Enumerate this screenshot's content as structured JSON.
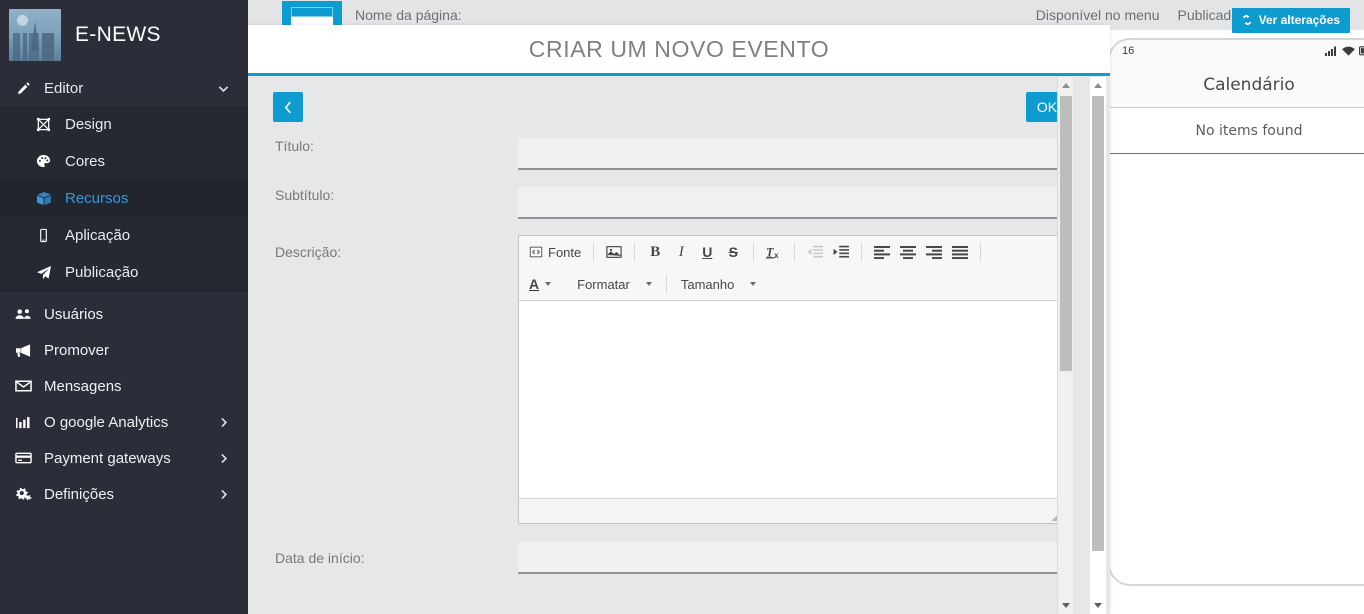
{
  "app": {
    "brand": "E-NEWS",
    "logo_icon": "city-skyline-logo"
  },
  "sidebar": {
    "editor_group": {
      "label": "Editor",
      "icon": "pencil-icon",
      "chevron": "chevron-down-icon",
      "expanded": true,
      "items": [
        {
          "label": "Design",
          "icon": "design-frame-icon",
          "active": false
        },
        {
          "label": "Cores",
          "icon": "palette-icon",
          "active": false
        },
        {
          "label": "Recursos",
          "icon": "cube-icon",
          "active": true
        },
        {
          "label": "Aplicação",
          "icon": "mobile-icon",
          "active": false
        },
        {
          "label": "Publicação",
          "icon": "paper-plane-icon",
          "active": false
        }
      ]
    },
    "items": [
      {
        "label": "Usuários",
        "icon": "users-icon",
        "chevron": false
      },
      {
        "label": "Promover",
        "icon": "megaphone-icon",
        "chevron": false
      },
      {
        "label": "Mensagens",
        "icon": "envelope-icon",
        "chevron": false
      },
      {
        "label": "O google Analytics",
        "icon": "bar-chart-icon",
        "chevron": true
      },
      {
        "label": "Payment gateways",
        "icon": "credit-card-icon",
        "chevron": true
      },
      {
        "label": "Definições",
        "icon": "gears-icon",
        "chevron": true
      }
    ]
  },
  "topbar": {
    "page_thumb_icon": "page-thumbnail-icon",
    "page_name_label": "Nome da página:",
    "menu_availability": "Disponível no menu",
    "published": "Publicados",
    "view_changes_button": "Ver alterações",
    "view_changes_icon": "refresh-icon"
  },
  "preview": {
    "status_time": "16",
    "status_icons": [
      "signal-icon",
      "wifi-icon",
      "battery-icon"
    ],
    "title": "Calendário",
    "empty_text": "No items found"
  },
  "modal": {
    "title": "CRIAR UM NOVO EVENTO",
    "back_button": "‹",
    "back_icon": "chevron-left-icon",
    "ok_button": "OK",
    "fields": {
      "titulo": {
        "label": "Título:",
        "value": "",
        "placeholder": ""
      },
      "subtitulo": {
        "label": "Subtítulo:",
        "value": "",
        "placeholder": ""
      },
      "descricao": {
        "label": "Descrição:",
        "value": ""
      },
      "data_inicio": {
        "label": "Data de início:",
        "value": "",
        "placeholder": ""
      }
    },
    "editor": {
      "row1": [
        {
          "type": "button",
          "name": "source-button",
          "label": "Fonte",
          "icon": "source-code-icon",
          "disabled": false
        },
        {
          "type": "sep"
        },
        {
          "type": "button",
          "name": "image-button",
          "label": "",
          "icon": "image-icon",
          "disabled": false
        },
        {
          "type": "sep"
        },
        {
          "type": "button",
          "name": "bold-button",
          "label": "B",
          "icon": "bold-icon",
          "disabled": false
        },
        {
          "type": "button",
          "name": "italic-button",
          "label": "I",
          "icon": "italic-icon",
          "disabled": false
        },
        {
          "type": "button",
          "name": "underline-button",
          "label": "U",
          "icon": "underline-icon",
          "disabled": false
        },
        {
          "type": "button",
          "name": "strikethrough-button",
          "label": "S",
          "icon": "strikethrough-icon",
          "disabled": false
        },
        {
          "type": "sep"
        },
        {
          "type": "button",
          "name": "remove-format-button",
          "label": "Tx",
          "icon": "remove-format-icon",
          "disabled": false
        },
        {
          "type": "sep"
        },
        {
          "type": "button",
          "name": "outdent-button",
          "label": "",
          "icon": "outdent-icon",
          "disabled": true
        },
        {
          "type": "button",
          "name": "indent-button",
          "label": "",
          "icon": "indent-icon",
          "disabled": false
        },
        {
          "type": "sep"
        },
        {
          "type": "button",
          "name": "align-left-button",
          "label": "",
          "icon": "align-left-icon",
          "disabled": false
        },
        {
          "type": "button",
          "name": "align-center-button",
          "label": "",
          "icon": "align-center-icon",
          "disabled": false
        },
        {
          "type": "button",
          "name": "align-right-button",
          "label": "",
          "icon": "align-right-icon",
          "disabled": false
        },
        {
          "type": "button",
          "name": "align-justify-button",
          "label": "",
          "icon": "align-justify-icon",
          "disabled": false
        },
        {
          "type": "sep"
        }
      ],
      "text_color_label": "A",
      "format_label": "Formatar",
      "size_label": "Tamanho"
    }
  },
  "colors": {
    "accent": "#0e9cd0",
    "sidebar_bg": "#2b2e38",
    "sidebar_sub_bg": "#262932",
    "sidebar_active_text": "#3b97db",
    "modal_body_bg": "#e6e7e9",
    "topbar_bg": "#e3e4e6",
    "label_text": "#77797c"
  }
}
